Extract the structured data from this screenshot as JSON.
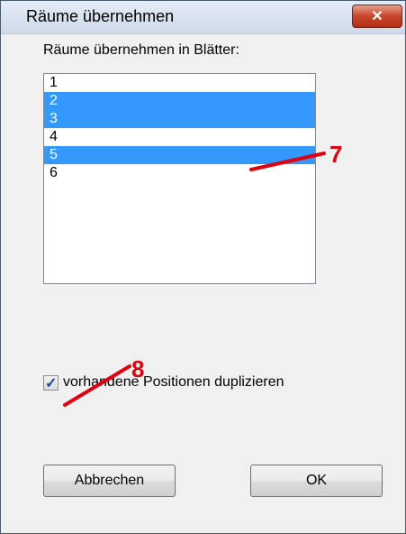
{
  "window": {
    "title": "Räume übernehmen",
    "close_glyph": "✕"
  },
  "list": {
    "label": "Räume übernehmen in Blätter:",
    "items": [
      {
        "label": "1",
        "selected": false
      },
      {
        "label": "2",
        "selected": true
      },
      {
        "label": "3",
        "selected": true
      },
      {
        "label": "4",
        "selected": false
      },
      {
        "label": "5",
        "selected": true
      },
      {
        "label": "6",
        "selected": false
      }
    ]
  },
  "option": {
    "label": "vorhandene Positionen duplizieren",
    "checked": true,
    "check_glyph": "✓"
  },
  "buttons": {
    "cancel": "Abbrechen",
    "ok": "OK"
  },
  "annotations": {
    "list_marker": "7",
    "checkbox_marker": "8",
    "color": "#e0000f"
  },
  "colors": {
    "selection": "#3399ff",
    "close_button": "#c9452b"
  }
}
